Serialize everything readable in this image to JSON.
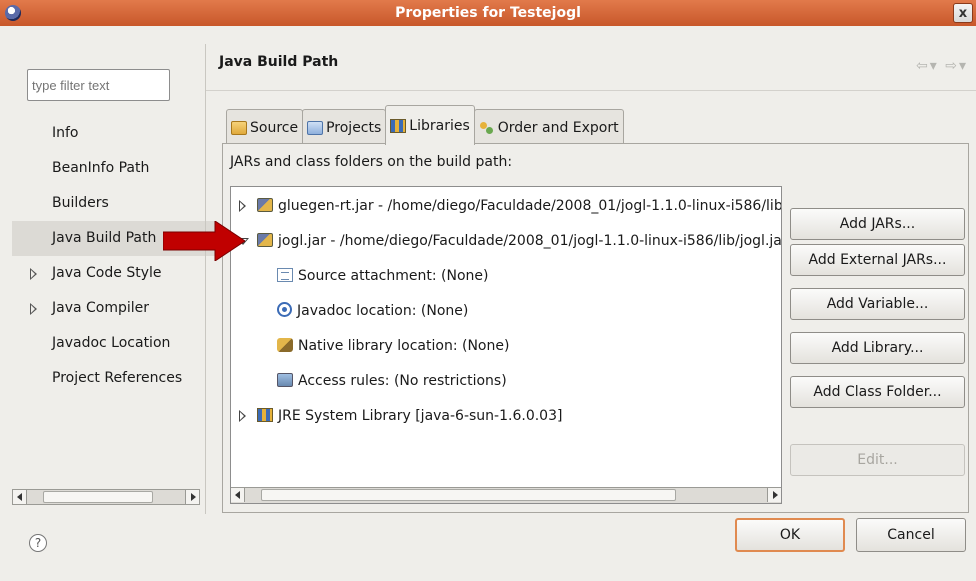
{
  "window": {
    "title": "Properties for Testejogl",
    "close_label": "x"
  },
  "left": {
    "filter_placeholder": "type filter text",
    "items": [
      {
        "label": "Info",
        "expandable": false,
        "selected": false
      },
      {
        "label": "BeanInfo Path",
        "expandable": false,
        "selected": false
      },
      {
        "label": "Builders",
        "expandable": false,
        "selected": false
      },
      {
        "label": "Java Build Path",
        "expandable": false,
        "selected": true
      },
      {
        "label": "Java Code Style",
        "expandable": true,
        "selected": false
      },
      {
        "label": "Java Compiler",
        "expandable": true,
        "selected": false
      },
      {
        "label": "Javadoc Location",
        "expandable": false,
        "selected": false
      },
      {
        "label": "Project References",
        "expandable": false,
        "selected": false
      }
    ]
  },
  "main": {
    "title": "Java Build Path",
    "tabs": [
      {
        "label": "Source",
        "icon": "source-folder-icon",
        "active": false
      },
      {
        "label": "Projects",
        "icon": "projects-icon",
        "active": false
      },
      {
        "label": "Libraries",
        "icon": "libraries-icon",
        "active": true
      },
      {
        "label": "Order and Export",
        "icon": "order-export-icon",
        "active": false
      }
    ],
    "panel_label": "JARs and class folders on the build path:",
    "tree": [
      {
        "label": "gluegen-rt.jar - /home/diego/Faculdade/2008_01/jogl-1.1.0-linux-i586/lib/gluegen-rt.jar",
        "icon": "jar-icon",
        "state": "closed",
        "level": 0
      },
      {
        "label": "jogl.jar - /home/diego/Faculdade/2008_01/jogl-1.1.0-linux-i586/lib/jogl.jar",
        "icon": "jar-icon",
        "state": "open",
        "level": 0
      },
      {
        "label": "Source attachment: (None)",
        "icon": "source-attachment-icon",
        "state": "none",
        "level": 1
      },
      {
        "label": "Javadoc location: (None)",
        "icon": "javadoc-icon",
        "state": "none",
        "level": 1
      },
      {
        "label": "Native library location: (None)",
        "icon": "native-library-icon",
        "state": "none",
        "level": 1
      },
      {
        "label": "Access rules: (No restrictions)",
        "icon": "access-rules-icon",
        "state": "none",
        "level": 1
      },
      {
        "label": "JRE System Library [java-6-sun-1.6.0.03]",
        "icon": "jre-library-icon",
        "state": "closed",
        "level": 0
      }
    ],
    "buttons": [
      {
        "label": "Add JARs...",
        "enabled": true
      },
      {
        "label": "Add External JARs...",
        "enabled": true
      },
      {
        "label": "Add Variable...",
        "enabled": true
      },
      {
        "label": "Add Library...",
        "enabled": true
      },
      {
        "label": "Add Class Folder...",
        "enabled": true
      },
      {
        "label": "Edit...",
        "enabled": false
      }
    ]
  },
  "footer": {
    "help_label": "?",
    "ok_label": "OK",
    "cancel_label": "Cancel"
  },
  "colors": {
    "titlebar": "#c8572a",
    "annotation_arrow": "#c00000",
    "dialog_bg": "#efeeea"
  }
}
